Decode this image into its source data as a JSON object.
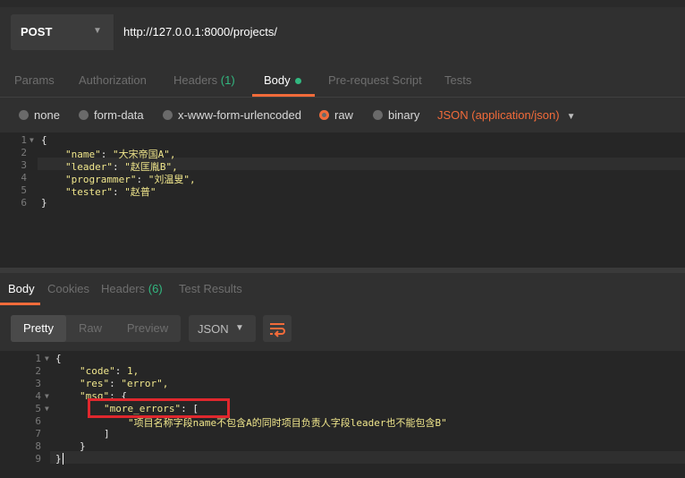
{
  "request": {
    "method": "POST",
    "url": "http://127.0.0.1:8000/projects/"
  },
  "request_tabs": [
    {
      "label": "Params"
    },
    {
      "label": "Authorization"
    },
    {
      "label": "Headers",
      "count": "(1)"
    },
    {
      "label": "Body",
      "active": true
    },
    {
      "label": "Pre-request Script"
    },
    {
      "label": "Tests"
    }
  ],
  "body_types": [
    {
      "label": "none",
      "selected": false
    },
    {
      "label": "form-data",
      "selected": false
    },
    {
      "label": "x-www-form-urlencoded",
      "selected": false
    },
    {
      "label": "raw",
      "selected": true
    },
    {
      "label": "binary",
      "selected": false
    }
  ],
  "content_type": "JSON (application/json)",
  "request_body_lines": [
    {
      "n": "1",
      "text": "{"
    },
    {
      "n": "2",
      "key": "\"name\"",
      "value": "\"大宋帝国A\","
    },
    {
      "n": "3",
      "key": "\"leader\"",
      "value": "\"赵匡胤B\","
    },
    {
      "n": "4",
      "key": "\"programmer\"",
      "value": "\"刘温叟\","
    },
    {
      "n": "5",
      "key": "\"tester\"",
      "value": "\"赵普\""
    },
    {
      "n": "6",
      "text": "}"
    }
  ],
  "response_tabs": [
    {
      "label": "Body",
      "active": true
    },
    {
      "label": "Cookies"
    },
    {
      "label": "Headers",
      "count": "(6)"
    },
    {
      "label": "Test Results"
    }
  ],
  "view_modes": [
    {
      "label": "Pretty",
      "active": true
    },
    {
      "label": "Raw"
    },
    {
      "label": "Preview"
    }
  ],
  "format": "JSON",
  "response_body_lines": [
    {
      "n": "1",
      "text": "{"
    },
    {
      "n": "2",
      "key": "\"code\"",
      "value": "1,"
    },
    {
      "n": "3",
      "key": "\"res\"",
      "value": "\"error\","
    },
    {
      "n": "4",
      "key": "\"msg\"",
      "value": "{"
    },
    {
      "n": "5",
      "key": "\"more_errors\"",
      "value": "["
    },
    {
      "n": "6",
      "text": "\"项目名称字段name不包含A的同时项目负责人字段leader也不能包含B\""
    },
    {
      "n": "7",
      "text": "]"
    },
    {
      "n": "8",
      "text": "}"
    },
    {
      "n": "9",
      "text": "}"
    }
  ],
  "colors": {
    "accent": "#f26b3a",
    "count_green": "#32b880",
    "annotation_red": "#e0272d",
    "background": "#303030"
  }
}
